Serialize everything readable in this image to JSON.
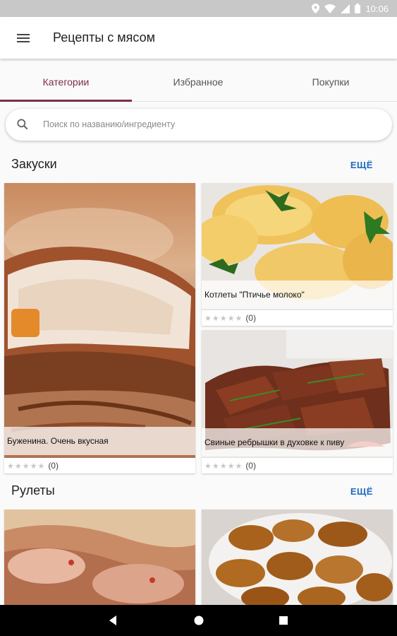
{
  "status_bar": {
    "time": "10:06"
  },
  "app_bar": {
    "title": "Рецепты с мясом",
    "menu_icon": "hamburger-icon"
  },
  "tabs": [
    {
      "label": "Категории",
      "active": true
    },
    {
      "label": "Избранное",
      "active": false
    },
    {
      "label": "Покупки",
      "active": false
    }
  ],
  "search": {
    "placeholder": "Поиск по названию/ингредиенту"
  },
  "sections": [
    {
      "title": "Закуски",
      "more_label": "ЕЩЁ",
      "recipes": [
        {
          "name": "Буженина. Очень вкусная",
          "rating_count": "(0)"
        },
        {
          "name": "Котлеты \"Птичье молоко\"",
          "rating_count": "(0)"
        },
        {
          "name": "Свиные ребрышки в духовке к пиву",
          "rating_count": "(0)"
        }
      ]
    },
    {
      "title": "Рулеты",
      "more_label": "ЕЩЁ",
      "recipes": []
    }
  ],
  "stars": "★★★★★",
  "colors": {
    "accent": "#7b2f46",
    "link": "#1e6bbf",
    "status_bar": "#c8c8c8"
  }
}
